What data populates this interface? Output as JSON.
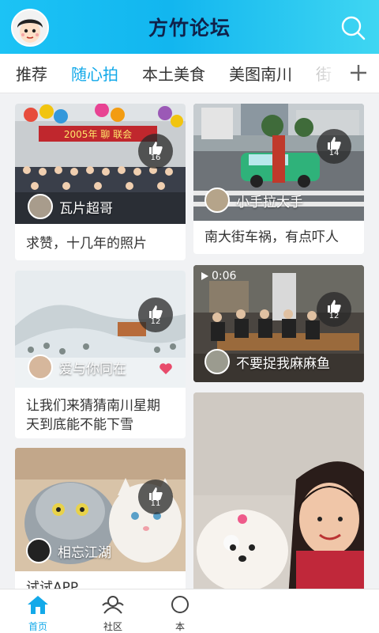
{
  "header": {
    "title": "方竹论坛",
    "avatar_icon": "cartoon-avatar",
    "search_icon": "search-icon"
  },
  "tabs": [
    {
      "label": "推荐",
      "active": false
    },
    {
      "label": "随心拍",
      "active": true
    },
    {
      "label": "本土美食",
      "active": false
    },
    {
      "label": "美图南川",
      "active": false
    },
    {
      "label": "街",
      "active": false
    }
  ],
  "tab_add_icon": "plus-icon",
  "posts": [
    {
      "author": "瓦片超哥",
      "likes": "16",
      "caption": "求赞，十几年的照片",
      "banner": "2005年 聊 联会"
    },
    {
      "author": "小手拉大手",
      "likes": "14",
      "caption": "南大街车祸，有点吓人"
    },
    {
      "author": "爱与你同在",
      "likes": "12",
      "caption_line1": "让我们来猜猜南川星期",
      "caption_line2": "天到底能不能下雪"
    },
    {
      "author": "不要捉我麻麻鱼",
      "likes": "12",
      "video_time": "0:06"
    },
    {
      "author": "相忘江湖",
      "likes": "11",
      "caption": "试试APP"
    },
    {
      "author": ""
    }
  ],
  "bottom_nav": [
    {
      "label": "首页",
      "icon": "home-icon",
      "active": true
    },
    {
      "label": "社区",
      "icon": "community-icon",
      "active": false
    },
    {
      "label": "本",
      "icon": "local-icon",
      "active": false
    }
  ],
  "colors": {
    "accent": "#13a9e9",
    "header_start": "#1cc3f5",
    "header_end": "#3fd6f2"
  }
}
